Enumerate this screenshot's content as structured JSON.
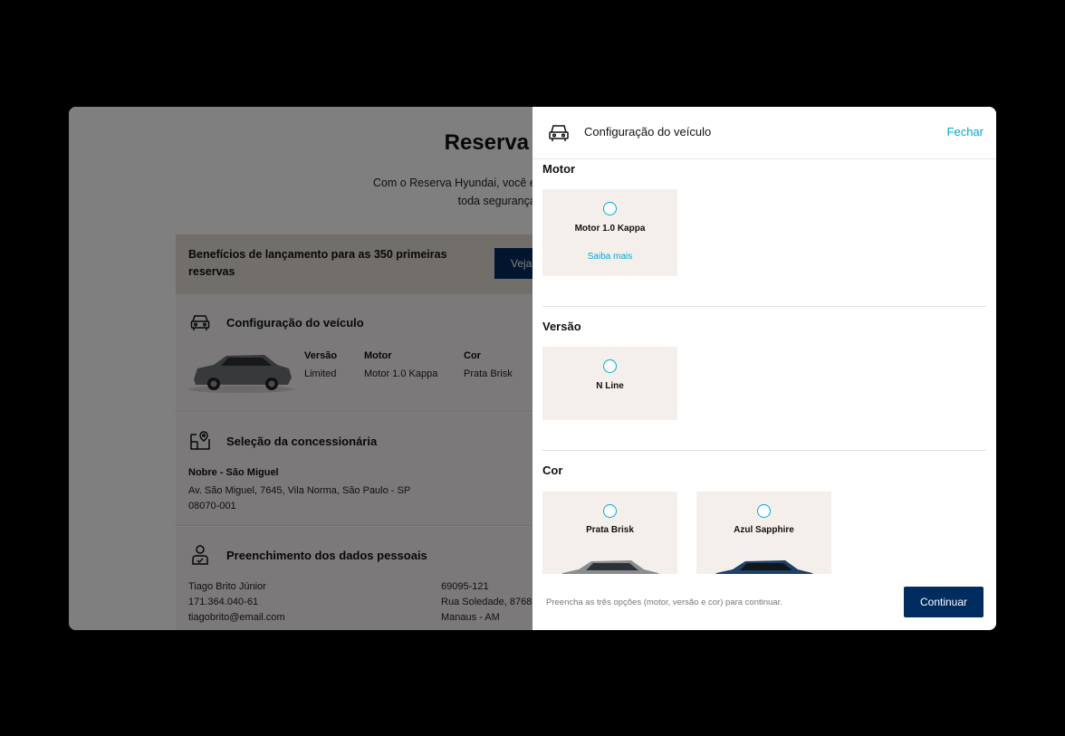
{
  "background": {
    "title": "Reserva Hyundai",
    "subtitle_line1": "Com o Reserva Hyundai, você escolhe o seu Hyundai preferido",
    "subtitle_line2": "toda segurança e praticidade.",
    "benefits_text": "Benefícios de lançamento para as 350 primeiras reservas",
    "benefits_button": "Veja",
    "vehicle_section": {
      "title": "Configuração do veículo",
      "version_label": "Versão",
      "version_value": "Limited",
      "motor_label": "Motor",
      "motor_value": "Motor 1.0 Kappa",
      "color_label": "Cor",
      "color_value": "Prata Brisk"
    },
    "dealer_section": {
      "title": "Seleção da concessionária",
      "name": "Nobre - São Miguel",
      "address": "Av. São Miguel, 7645, Vila Norma, São Paulo - SP",
      "zip": "08070-001"
    },
    "personal_section": {
      "title": "Preenchimento dos dados pessoais",
      "name": "Tiago Brito Júnior",
      "cpf": "171.364.040-61",
      "email": "tiagobrito@email.com",
      "zip": "69095-121",
      "street": "Rua Soledade, 8768",
      "city": "Manaus - AM"
    }
  },
  "panel": {
    "title": "Configuração do veículo",
    "close_label": "Fechar",
    "motor": {
      "title": "Motor",
      "option_label": "Motor 1.0 Kappa",
      "link": "Saiba mais"
    },
    "version": {
      "title": "Versão",
      "option_label": "N Line"
    },
    "color": {
      "title": "Cor",
      "options": [
        {
          "label": "Prata Brisk",
          "color": "#8a8d90"
        },
        {
          "label": "Azul Sapphire",
          "color": "#1f3f66"
        }
      ]
    },
    "footer_hint": "Preencha as três opções (motor, versão e cor) para continuar.",
    "continue_button": "Continuar"
  },
  "colors": {
    "brand_navy": "#002c5f",
    "accent_cyan": "#00aad2",
    "option_bg": "#f4efeb"
  }
}
